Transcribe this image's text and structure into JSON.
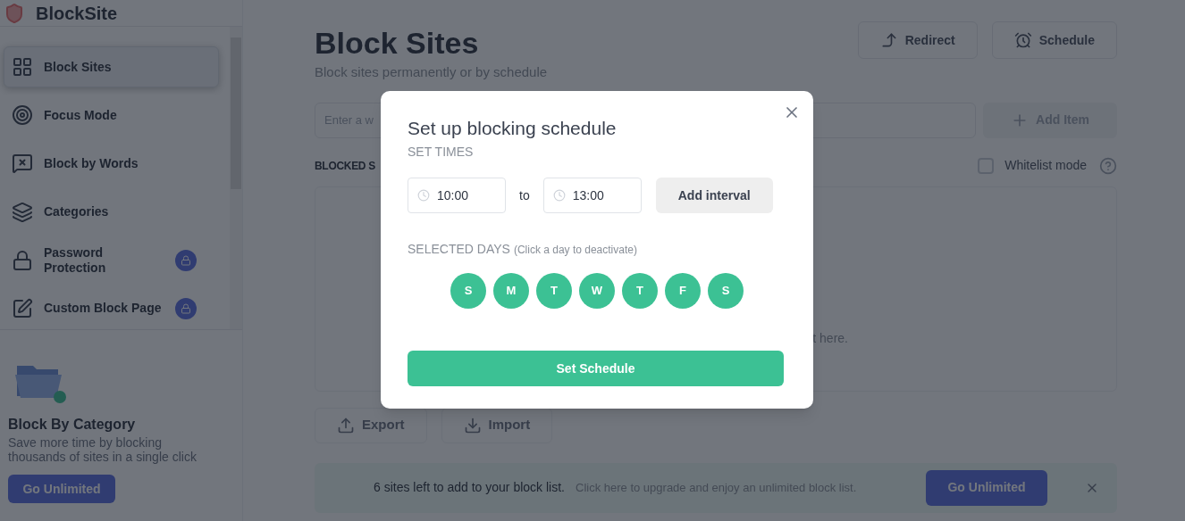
{
  "sidebar": {
    "brand": "BlockSite",
    "items": [
      {
        "label": "Block Sites",
        "selected": true,
        "locked": false
      },
      {
        "label": "Focus Mode",
        "selected": false,
        "locked": false
      },
      {
        "label": "Block by Words",
        "selected": false,
        "locked": false
      },
      {
        "label": "Categories",
        "selected": false,
        "locked": false
      },
      {
        "label": "Password Protection",
        "selected": false,
        "locked": true
      },
      {
        "label": "Custom Block Page",
        "selected": false,
        "locked": true
      }
    ],
    "promo": {
      "title": "Block By Category",
      "text": "Save more time by blocking thousands of sites in a single click",
      "button": "Go Unlimited"
    }
  },
  "page": {
    "title": "Block Sites",
    "subtitle": "Block sites permanently or by schedule",
    "actions": [
      {
        "label": "Redirect"
      },
      {
        "label": "Schedule"
      }
    ],
    "site_input": {
      "placeholder": "Enter a w"
    },
    "add_button": "Add Item",
    "list_heading": "BLOCKED S",
    "whitelist": {
      "label": "Whitelist mode",
      "checked": false
    },
    "list_hint": "t here.",
    "footer_buttons": [
      {
        "label": "Export"
      },
      {
        "label": "Import"
      }
    ],
    "banner": {
      "count_text": "6 sites left to add to your block list.",
      "upgrade_text": "Click here to upgrade and enjoy an unlimited block list.",
      "button": "Go Unlimited"
    }
  },
  "dialog": {
    "title": "Set up blocking schedule",
    "times_label": "SET TIMES",
    "from": "10:00",
    "separator": "to",
    "until": "13:00",
    "add_interval": "Add interval",
    "days_label": "SELECTED DAYS",
    "days_hint": "(Click a day to deactivate)",
    "days": [
      {
        "label": "S",
        "selected": true
      },
      {
        "label": "M",
        "selected": true
      },
      {
        "label": "T",
        "selected": true
      },
      {
        "label": "W",
        "selected": true
      },
      {
        "label": "T",
        "selected": true
      },
      {
        "label": "F",
        "selected": true
      },
      {
        "label": "S",
        "selected": true
      }
    ],
    "submit": "Set Schedule"
  }
}
